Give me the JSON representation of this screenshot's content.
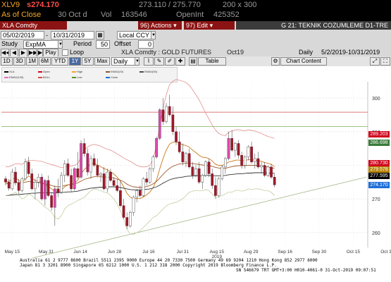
{
  "quote": {
    "ticker": "XLV9",
    "price": "s274.170",
    "range": "273.110 / 275.770",
    "size": "200 x 300",
    "as_of_label": "As of Close",
    "as_of_date": "30 Oct d",
    "vol_label": "Vol",
    "vol_value": "163546",
    "open_int_label": "OpenInt",
    "open_int_value": "425352"
  },
  "toolbar": {
    "security": "XLA Comdty",
    "start_date": "05/02/2019",
    "end_date": "10/31/2019",
    "currency": "Local CCY",
    "actions_num": "96)",
    "actions_label": "Actions",
    "edit_num": "97)",
    "edit_label": "Edit",
    "window_title": "G 21: TEKNIK COZUMLEME D1-TRE",
    "study_label": "Study",
    "study_value": "ExpMA",
    "period_label": "Period",
    "period_value": "50",
    "offset_label": "Offset",
    "offset_value": "0",
    "play_label": "Play",
    "loop_label": "Loop",
    "chart_title": "XLA Comdty : GOLD FUTURES",
    "contract": "Oct19",
    "frequency_label": "Daily",
    "date_range": "5/2/2019-10/31/2019",
    "periods": [
      "1D",
      "3D",
      "1M",
      "6M",
      "YTD",
      "1Y",
      "5Y",
      "Max"
    ],
    "active_period": "1Y",
    "freq_select": "Daily",
    "table_label": "Table",
    "chart_content_label": "Chart Content"
  },
  "legend": [
    {
      "label": "XLA",
      "color": "#000000"
    },
    {
      "label": "Open",
      "color": "#d0021b"
    },
    {
      "label": "High",
      "color": "#f5a623"
    },
    {
      "label": "EMAV(20)",
      "color": "#8b572a"
    },
    {
      "label": "EMAV(50)",
      "color": "#4a4a4a"
    },
    {
      "label": "EMAV(100)",
      "color": "#e86ec8"
    },
    {
      "label": "BOLL",
      "color": "#d94a4a"
    },
    {
      "label": "Low",
      "color": "#5b8f29"
    },
    {
      "label": "Close",
      "color": "#1e6fd9"
    }
  ],
  "price_tags": [
    {
      "value": "289.203",
      "color": "#d0021b"
    },
    {
      "value": "286.698",
      "color": "#3a7a3a"
    },
    {
      "value": "280.730",
      "color": "#d0021b"
    },
    {
      "value": "279.578",
      "color": "#b8860b"
    },
    {
      "value": "277.595",
      "color": "#000000"
    },
    {
      "value": "274.170",
      "color": "#1e6fd9"
    }
  ],
  "footer": {
    "line1": "Australia 61 2 9777 8600 Brazil 5511 2395 9000 Europe 44 20 7330 7500 Germany 49 69 9204 1210 Hong Kong 852 2977 6000",
    "line2": "Japan 81 3 3201 8900          Singapore 65 6212 1000          U.S. 1 212 318 2000          Copyright 2019 Bloomberg Finance L.P.",
    "line3": "SN 546679 TRT  GMT+3:00 H010-4061-0 31-Oct-2019 09:07:51"
  },
  "chart_data": {
    "type": "candlestick",
    "title": "XLA Comdty : GOLD FUTURES",
    "x_ticks": [
      "May 15",
      "May 31",
      "Jun 14",
      "Jun 28",
      "Jul 16",
      "Jul 31",
      "Aug 15",
      "Aug 29",
      "Sep 16",
      "Sep 30",
      "Oct 15",
      "Oct 31",
      "Nov 15"
    ],
    "x_year_label": "2019",
    "y_ticks": [
      260,
      270,
      280,
      290,
      300
    ],
    "ylim": [
      256,
      304
    ],
    "ohlc": [
      [
        276.0,
        276.8,
        274.0,
        275.0
      ],
      [
        275.0,
        276.0,
        272.5,
        273.2
      ],
      [
        273.0,
        279.0,
        272.5,
        278.0
      ],
      [
        278.0,
        279.5,
        274.0,
        274.8
      ],
      [
        274.8,
        276.0,
        271.5,
        272.5
      ],
      [
        272.5,
        276.5,
        272.0,
        276.0
      ],
      [
        276.0,
        282.0,
        275.5,
        281.0
      ],
      [
        281.0,
        282.5,
        277.0,
        277.5
      ],
      [
        277.5,
        279.0,
        272.5,
        273.0
      ],
      [
        273.0,
        276.0,
        270.0,
        275.0
      ],
      [
        275.0,
        277.5,
        273.5,
        276.5
      ],
      [
        276.5,
        277.5,
        269.5,
        270.0
      ],
      [
        270.0,
        276.0,
        268.0,
        275.5
      ],
      [
        275.5,
        277.0,
        270.5,
        271.0
      ],
      [
        271.0,
        272.0,
        266.5,
        267.5
      ],
      [
        267.5,
        274.0,
        262.0,
        273.0
      ],
      [
        273.0,
        276.0,
        270.5,
        272.0
      ],
      [
        272.0,
        278.0,
        271.5,
        277.0
      ],
      [
        277.0,
        281.5,
        275.0,
        280.5
      ],
      [
        280.5,
        282.0,
        276.5,
        277.0
      ],
      [
        277.0,
        279.0,
        272.0,
        273.0
      ],
      [
        273.0,
        279.5,
        272.5,
        279.0
      ],
      [
        279.0,
        284.0,
        276.0,
        276.5
      ],
      [
        276.5,
        287.5,
        276.0,
        286.5
      ],
      [
        286.5,
        288.0,
        282.5,
        283.5
      ],
      [
        283.5,
        285.0,
        277.0,
        278.0
      ],
      [
        278.0,
        283.0,
        276.0,
        282.0
      ],
      [
        282.0,
        283.5,
        279.5,
        280.0
      ],
      [
        280.0,
        282.0,
        276.5,
        277.0
      ],
      [
        277.0,
        278.0,
        275.0,
        277.5
      ],
      [
        277.5,
        279.5,
        272.5,
        273.0
      ],
      [
        273.0,
        279.0,
        272.0,
        278.0
      ],
      [
        278.0,
        279.0,
        275.0,
        275.5
      ],
      [
        275.5,
        276.5,
        273.5,
        274.0
      ],
      [
        274.0,
        276.0,
        272.0,
        272.5
      ],
      [
        272.5,
        275.5,
        267.5,
        268.0
      ],
      [
        268.0,
        270.0,
        264.0,
        264.5
      ],
      [
        264.5,
        266.0,
        261.0,
        262.0
      ],
      [
        262.0,
        266.5,
        261.5,
        266.0
      ],
      [
        266.0,
        271.0,
        265.0,
        270.5
      ],
      [
        270.5,
        273.0,
        269.0,
        272.5
      ],
      [
        272.5,
        274.0,
        270.5,
        271.0
      ],
      [
        271.0,
        276.5,
        270.5,
        276.0
      ],
      [
        276.0,
        278.0,
        274.0,
        275.0
      ],
      [
        275.0,
        279.5,
        274.5,
        279.0
      ],
      [
        279.0,
        283.0,
        278.0,
        282.5
      ],
      [
        282.5,
        288.5,
        282.0,
        288.0
      ],
      [
        288.0,
        297.0,
        287.5,
        296.5
      ],
      [
        296.5,
        300.0,
        292.0,
        293.0
      ],
      [
        293.0,
        298.5,
        292.5,
        297.5
      ],
      [
        297.5,
        301.0,
        294.5,
        295.0
      ],
      [
        295.0,
        297.5,
        289.0,
        290.0
      ],
      [
        290.0,
        291.5,
        286.0,
        287.0
      ],
      [
        287.0,
        290.0,
        283.5,
        284.0
      ],
      [
        284.0,
        286.5,
        280.0,
        281.0
      ],
      [
        281.0,
        284.0,
        279.5,
        283.5
      ],
      [
        283.5,
        285.0,
        279.0,
        279.5
      ],
      [
        279.5,
        281.0,
        276.0,
        277.0
      ],
      [
        277.0,
        280.0,
        276.5,
        279.0
      ],
      [
        279.0,
        281.0,
        274.5,
        275.0
      ],
      [
        275.0,
        277.5,
        273.0,
        277.0
      ],
      [
        277.0,
        281.5,
        276.5,
        281.0
      ],
      [
        281.0,
        282.0,
        276.5,
        277.5
      ],
      [
        277.5,
        279.0,
        273.0,
        274.0
      ],
      [
        274.0,
        276.5,
        270.0,
        271.0
      ],
      [
        271.0,
        276.5,
        270.5,
        276.0
      ],
      [
        276.0,
        280.0,
        275.5,
        279.5
      ],
      [
        279.5,
        282.5,
        277.5,
        282.0
      ],
      [
        282.0,
        290.0,
        281.5,
        288.0
      ],
      [
        288.0,
        290.5,
        284.0,
        284.5
      ],
      [
        284.5,
        287.0,
        282.5,
        286.5
      ],
      [
        286.5,
        287.5,
        282.0,
        283.0
      ],
      [
        283.0,
        284.0,
        279.0,
        280.0
      ],
      [
        280.0,
        283.0,
        279.0,
        282.5
      ],
      [
        282.5,
        286.0,
        281.5,
        285.5
      ],
      [
        285.5,
        287.0,
        280.5,
        281.0
      ],
      [
        281.0,
        283.5,
        279.0,
        282.0
      ],
      [
        282.0,
        284.0,
        279.0,
        279.5
      ],
      [
        279.5,
        281.0,
        277.5,
        280.0
      ],
      [
        280.0,
        281.0,
        276.5,
        277.0
      ],
      [
        277.0,
        280.0,
        276.5,
        279.5
      ],
      [
        279.5,
        280.5,
        276.0,
        276.5
      ],
      [
        276.5,
        277.5,
        273.5,
        274.2
      ]
    ],
    "series": [
      {
        "name": "EMAV(20)",
        "color": "#c8781e",
        "values": [
          275.0,
          275.2,
          275.8,
          276.3,
          275.5,
          275.0,
          275.9,
          276.8,
          276.3,
          275.5,
          275.4,
          274.8,
          274.2,
          273.8,
          273.0,
          272.2,
          272.0,
          272.6,
          273.6,
          274.2,
          274.2,
          274.7,
          275.6,
          277.4,
          278.8,
          279.6,
          280.4,
          280.6,
          280.1,
          279.6,
          279.0,
          278.7,
          278.1,
          277.4,
          276.5,
          275.3,
          273.6,
          271.7,
          270.5,
          270.1,
          270.1,
          270.1,
          270.6,
          271.2,
          272.1,
          273.4,
          275.6,
          279.0,
          282.0,
          284.6,
          286.3,
          286.9,
          286.9,
          286.6,
          286.1,
          285.9,
          285.4,
          284.5,
          283.8,
          283.0,
          282.4,
          282.3,
          282.0,
          281.3,
          280.3,
          280.0,
          280.0,
          280.2,
          281.0,
          281.2,
          281.5,
          281.6,
          281.4,
          281.4,
          281.7,
          281.6,
          281.6,
          281.4,
          281.2,
          280.8,
          280.6,
          280.3,
          279.6
        ]
      },
      {
        "name": "EMAV(50)",
        "color": "#a05a2c",
        "values": [
          274.5,
          274.6,
          274.8,
          275.0,
          274.9,
          274.8,
          275.0,
          275.2,
          275.1,
          274.9,
          274.9,
          274.7,
          274.5,
          274.3,
          274.0,
          273.7,
          273.6,
          273.7,
          274.0,
          274.2,
          274.3,
          274.5,
          274.8,
          275.3,
          275.8,
          276.1,
          276.4,
          276.6,
          276.6,
          276.6,
          276.5,
          276.5,
          276.4,
          276.2,
          275.9,
          275.6,
          275.1,
          274.4,
          273.9,
          273.6,
          273.5,
          273.4,
          273.5,
          273.7,
          274.0,
          274.5,
          275.2,
          276.2,
          277.3,
          278.3,
          279.1,
          279.7,
          280.1,
          280.4,
          280.5,
          280.6,
          280.6,
          280.5,
          280.4,
          280.2,
          280.1,
          280.0,
          279.9,
          279.7,
          279.4,
          279.2,
          279.1,
          279.1,
          279.4,
          279.6,
          279.8,
          279.9,
          279.9,
          279.9,
          280.0,
          280.0,
          280.0,
          279.9,
          279.8,
          279.7,
          279.5,
          279.3,
          279.1
        ]
      },
      {
        "name": "EMAV(100)",
        "color": "#333333",
        "values": [
          271.0,
          271.1,
          271.2,
          271.3,
          271.3,
          271.4,
          271.5,
          271.6,
          271.7,
          271.7,
          271.8,
          271.8,
          271.8,
          271.8,
          271.8,
          271.8,
          271.8,
          271.9,
          272.0,
          272.1,
          272.1,
          272.2,
          272.3,
          272.6,
          272.8,
          273.0,
          273.2,
          273.3,
          273.4,
          273.5,
          273.5,
          273.6,
          273.6,
          273.6,
          273.5,
          273.4,
          273.2,
          273.0,
          272.8,
          272.7,
          272.7,
          272.7,
          272.8,
          272.9,
          273.0,
          273.3,
          273.6,
          274.1,
          274.7,
          275.2,
          275.7,
          276.0,
          276.2,
          276.4,
          276.5,
          276.7,
          276.8,
          276.8,
          276.9,
          276.9,
          276.9,
          277.0,
          277.0,
          276.9,
          276.9,
          276.9,
          276.9,
          277.0,
          277.2,
          277.3,
          277.4,
          277.5,
          277.5,
          277.6,
          277.7,
          277.7,
          277.8,
          277.8,
          277.8,
          277.8,
          277.7,
          277.7,
          277.6
        ]
      },
      {
        "name": "BOLL upper",
        "color": "#e08080",
        "values": [
          279.5,
          279.6,
          280.0,
          280.5,
          280.5,
          280.3,
          281.0,
          281.5,
          281.5,
          281.4,
          281.3,
          281.2,
          280.8,
          280.5,
          280.2,
          280.0,
          279.6,
          279.3,
          279.5,
          279.8,
          279.8,
          280.0,
          280.5,
          282.5,
          284.5,
          285.5,
          286.0,
          286.2,
          286.0,
          285.7,
          285.2,
          284.8,
          284.5,
          284.0,
          283.4,
          282.8,
          282.2,
          281.7,
          281.2,
          280.6,
          280.0,
          279.6,
          279.5,
          279.6,
          280.0,
          282.0,
          286.0,
          292.0,
          297.0,
          301.0,
          304.0,
          305.0,
          305.5,
          305.3,
          305.0,
          304.6,
          303.8,
          302.5,
          301.0,
          299.5,
          297.5,
          295.5,
          293.8,
          292.0,
          290.5,
          289.5,
          289.0,
          288.8,
          289.8,
          290.2,
          290.5,
          290.6,
          290.4,
          290.3,
          290.5,
          290.4,
          290.2,
          289.8,
          289.5,
          289.0,
          288.6,
          288.3,
          288.0
        ]
      },
      {
        "name": "BOLL lower",
        "color": "#b8c890",
        "values": [
          271.0,
          271.2,
          271.5,
          272.0,
          271.0,
          270.0,
          270.5,
          271.5,
          271.0,
          270.0,
          269.5,
          268.5,
          267.5,
          267.0,
          266.0,
          264.5,
          264.0,
          265.0,
          267.0,
          268.0,
          268.5,
          269.0,
          269.5,
          270.0,
          270.5,
          271.5,
          272.5,
          273.0,
          272.8,
          272.5,
          272.0,
          271.8,
          271.0,
          270.0,
          268.5,
          266.5,
          264.0,
          261.0,
          259.5,
          259.5,
          260.0,
          260.5,
          261.5,
          262.5,
          263.5,
          264.5,
          265.0,
          266.0,
          267.0,
          268.0,
          268.5,
          268.8,
          269.0,
          269.5,
          270.0,
          271.0,
          272.0,
          272.3,
          272.5,
          272.5,
          272.5,
          272.8,
          272.5,
          271.5,
          270.5,
          270.5,
          271.0,
          271.5,
          272.0,
          272.0,
          272.5,
          272.6,
          272.3,
          272.5,
          273.0,
          272.8,
          273.0,
          273.0,
          272.8,
          272.5,
          272.5,
          272.0,
          271.0
        ]
      }
    ],
    "horizontal_lines": [
      {
        "value": 295.8,
        "color": "#d05050"
      },
      {
        "value": 291.5,
        "color": "#7ab05a"
      }
    ],
    "trendline": {
      "from": [
        0,
        250.5
      ],
      "to": [
        110,
        276.5
      ],
      "color": "#9ab07a"
    }
  }
}
